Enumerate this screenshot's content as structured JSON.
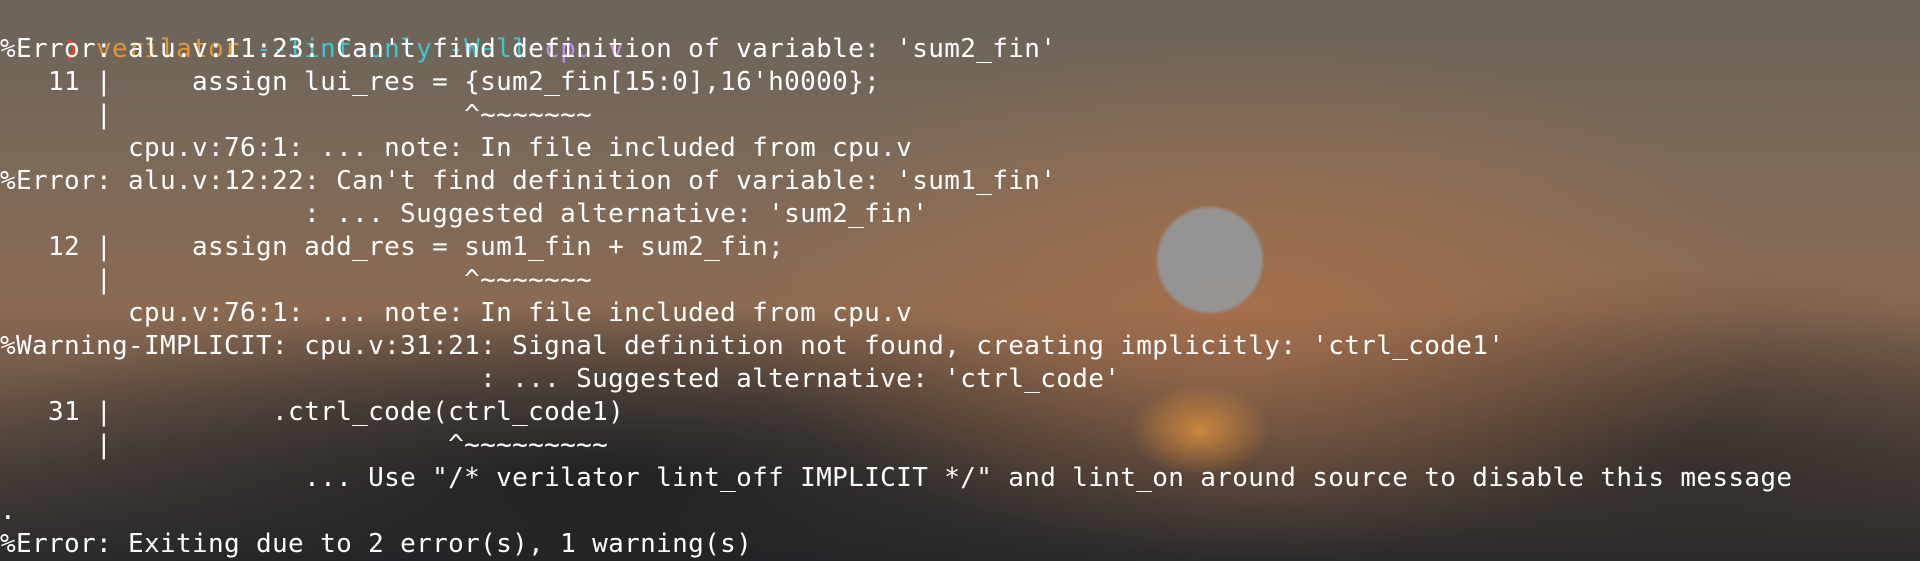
{
  "prompt": {
    "symbol": "❯",
    "command": "verilator",
    "args": "--lint-only -Wall",
    "file": "cpu.v"
  },
  "output_lines": [
    "%Error: alu.v:11:23: Can't find definition of variable: 'sum2_fin'",
    "   11 |     assign lui_res = {sum2_fin[15:0],16'h0000};",
    "      |                      ^~~~~~~~",
    "        cpu.v:76:1: ... note: In file included from cpu.v",
    "%Error: alu.v:12:22: Can't find definition of variable: 'sum1_fin'",
    "                   : ... Suggested alternative: 'sum2_fin'",
    "   12 |     assign add_res = sum1_fin + sum2_fin;",
    "      |                      ^~~~~~~~",
    "        cpu.v:76:1: ... note: In file included from cpu.v",
    "%Warning-IMPLICIT: cpu.v:31:21: Signal definition not found, creating implicitly: 'ctrl_code1'",
    "                              : ... Suggested alternative: 'ctrl_code'",
    "   31 |          .ctrl_code(ctrl_code1)",
    "      |                     ^~~~~~~~~~",
    "                   ... Use \"/* verilator lint_off IMPLICIT */\" and lint_on around source to disable this message",
    ".",
    "%Error: Exiting due to 2 error(s), 1 warning(s)"
  ],
  "colors": {
    "prompt_symbol": "#e0442f",
    "command": "#e0963c",
    "args": "#3fc4d2",
    "file": "#c08be8",
    "text": "#ffffff"
  }
}
